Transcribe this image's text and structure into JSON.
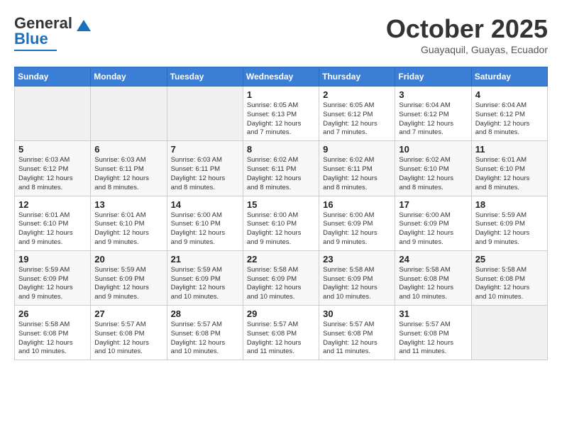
{
  "header": {
    "logo_line1": "General",
    "logo_line2": "Blue",
    "month": "October 2025",
    "location": "Guayaquil, Guayas, Ecuador"
  },
  "weekdays": [
    "Sunday",
    "Monday",
    "Tuesday",
    "Wednesday",
    "Thursday",
    "Friday",
    "Saturday"
  ],
  "weeks": [
    [
      {
        "day": "",
        "text": ""
      },
      {
        "day": "",
        "text": ""
      },
      {
        "day": "",
        "text": ""
      },
      {
        "day": "1",
        "text": "Sunrise: 6:05 AM\nSunset: 6:13 PM\nDaylight: 12 hours\nand 7 minutes."
      },
      {
        "day": "2",
        "text": "Sunrise: 6:05 AM\nSunset: 6:12 PM\nDaylight: 12 hours\nand 7 minutes."
      },
      {
        "day": "3",
        "text": "Sunrise: 6:04 AM\nSunset: 6:12 PM\nDaylight: 12 hours\nand 7 minutes."
      },
      {
        "day": "4",
        "text": "Sunrise: 6:04 AM\nSunset: 6:12 PM\nDaylight: 12 hours\nand 8 minutes."
      }
    ],
    [
      {
        "day": "5",
        "text": "Sunrise: 6:03 AM\nSunset: 6:12 PM\nDaylight: 12 hours\nand 8 minutes."
      },
      {
        "day": "6",
        "text": "Sunrise: 6:03 AM\nSunset: 6:11 PM\nDaylight: 12 hours\nand 8 minutes."
      },
      {
        "day": "7",
        "text": "Sunrise: 6:03 AM\nSunset: 6:11 PM\nDaylight: 12 hours\nand 8 minutes."
      },
      {
        "day": "8",
        "text": "Sunrise: 6:02 AM\nSunset: 6:11 PM\nDaylight: 12 hours\nand 8 minutes."
      },
      {
        "day": "9",
        "text": "Sunrise: 6:02 AM\nSunset: 6:11 PM\nDaylight: 12 hours\nand 8 minutes."
      },
      {
        "day": "10",
        "text": "Sunrise: 6:02 AM\nSunset: 6:10 PM\nDaylight: 12 hours\nand 8 minutes."
      },
      {
        "day": "11",
        "text": "Sunrise: 6:01 AM\nSunset: 6:10 PM\nDaylight: 12 hours\nand 8 minutes."
      }
    ],
    [
      {
        "day": "12",
        "text": "Sunrise: 6:01 AM\nSunset: 6:10 PM\nDaylight: 12 hours\nand 9 minutes."
      },
      {
        "day": "13",
        "text": "Sunrise: 6:01 AM\nSunset: 6:10 PM\nDaylight: 12 hours\nand 9 minutes."
      },
      {
        "day": "14",
        "text": "Sunrise: 6:00 AM\nSunset: 6:10 PM\nDaylight: 12 hours\nand 9 minutes."
      },
      {
        "day": "15",
        "text": "Sunrise: 6:00 AM\nSunset: 6:10 PM\nDaylight: 12 hours\nand 9 minutes."
      },
      {
        "day": "16",
        "text": "Sunrise: 6:00 AM\nSunset: 6:09 PM\nDaylight: 12 hours\nand 9 minutes."
      },
      {
        "day": "17",
        "text": "Sunrise: 6:00 AM\nSunset: 6:09 PM\nDaylight: 12 hours\nand 9 minutes."
      },
      {
        "day": "18",
        "text": "Sunrise: 5:59 AM\nSunset: 6:09 PM\nDaylight: 12 hours\nand 9 minutes."
      }
    ],
    [
      {
        "day": "19",
        "text": "Sunrise: 5:59 AM\nSunset: 6:09 PM\nDaylight: 12 hours\nand 9 minutes."
      },
      {
        "day": "20",
        "text": "Sunrise: 5:59 AM\nSunset: 6:09 PM\nDaylight: 12 hours\nand 9 minutes."
      },
      {
        "day": "21",
        "text": "Sunrise: 5:59 AM\nSunset: 6:09 PM\nDaylight: 12 hours\nand 10 minutes."
      },
      {
        "day": "22",
        "text": "Sunrise: 5:58 AM\nSunset: 6:09 PM\nDaylight: 12 hours\nand 10 minutes."
      },
      {
        "day": "23",
        "text": "Sunrise: 5:58 AM\nSunset: 6:09 PM\nDaylight: 12 hours\nand 10 minutes."
      },
      {
        "day": "24",
        "text": "Sunrise: 5:58 AM\nSunset: 6:08 PM\nDaylight: 12 hours\nand 10 minutes."
      },
      {
        "day": "25",
        "text": "Sunrise: 5:58 AM\nSunset: 6:08 PM\nDaylight: 12 hours\nand 10 minutes."
      }
    ],
    [
      {
        "day": "26",
        "text": "Sunrise: 5:58 AM\nSunset: 6:08 PM\nDaylight: 12 hours\nand 10 minutes."
      },
      {
        "day": "27",
        "text": "Sunrise: 5:57 AM\nSunset: 6:08 PM\nDaylight: 12 hours\nand 10 minutes."
      },
      {
        "day": "28",
        "text": "Sunrise: 5:57 AM\nSunset: 6:08 PM\nDaylight: 12 hours\nand 10 minutes."
      },
      {
        "day": "29",
        "text": "Sunrise: 5:57 AM\nSunset: 6:08 PM\nDaylight: 12 hours\nand 11 minutes."
      },
      {
        "day": "30",
        "text": "Sunrise: 5:57 AM\nSunset: 6:08 PM\nDaylight: 12 hours\nand 11 minutes."
      },
      {
        "day": "31",
        "text": "Sunrise: 5:57 AM\nSunset: 6:08 PM\nDaylight: 12 hours\nand 11 minutes."
      },
      {
        "day": "",
        "text": ""
      }
    ]
  ]
}
